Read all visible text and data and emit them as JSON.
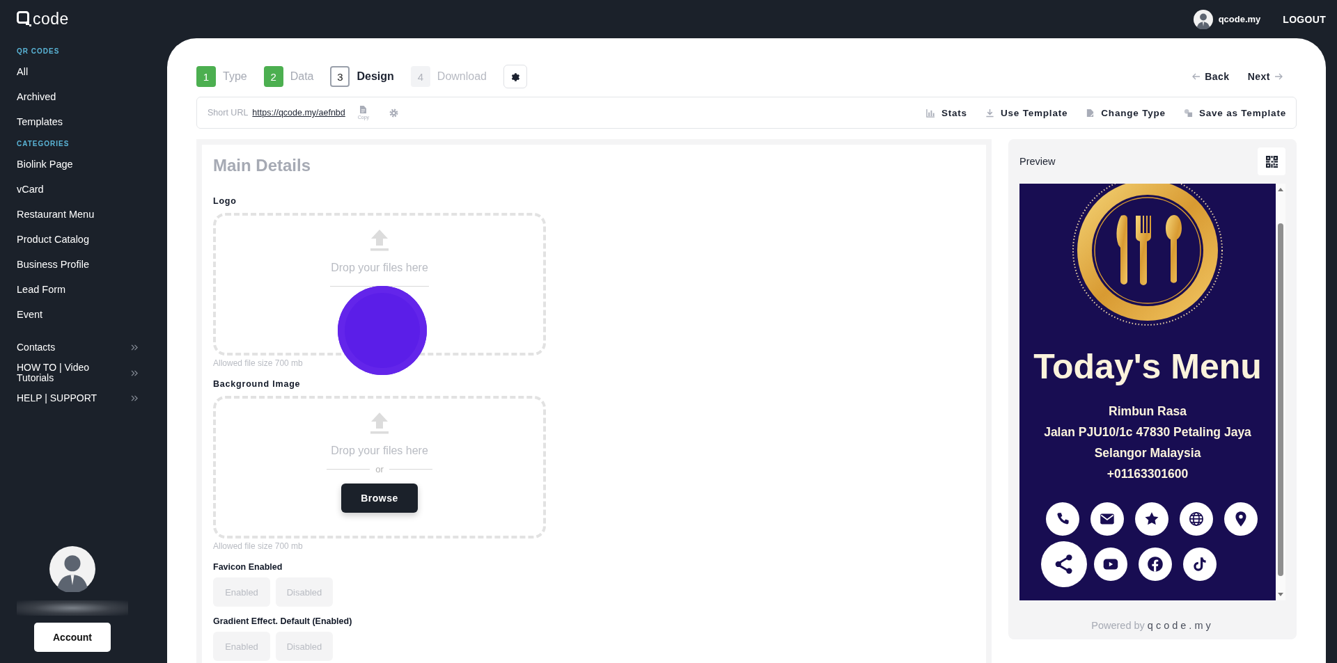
{
  "brand": {
    "text": "code"
  },
  "user": {
    "name": "qcode.my",
    "logout": "LOGOUT"
  },
  "sidebar": {
    "sections": [
      {
        "heading": "QR CODES",
        "items": [
          {
            "label": "All"
          },
          {
            "label": "Archived"
          },
          {
            "label": "Templates"
          }
        ]
      },
      {
        "heading": "CATEGORIES",
        "items": [
          {
            "label": "Biolink Page"
          },
          {
            "label": "vCard"
          },
          {
            "label": "Restaurant Menu"
          },
          {
            "label": "Product Catalog"
          },
          {
            "label": "Business Profile"
          },
          {
            "label": "Lead Form"
          },
          {
            "label": "Event"
          }
        ]
      }
    ],
    "links": [
      {
        "label": "Contacts"
      },
      {
        "label": "HOW TO | Video Tutorials"
      },
      {
        "label": "HELP | SUPPORT"
      }
    ],
    "account_button": "Account"
  },
  "steps": [
    {
      "number": "1",
      "label": "Type",
      "done": true,
      "selected": false
    },
    {
      "number": "2",
      "label": "Data",
      "done": true,
      "selected": false
    },
    {
      "number": "3",
      "label": "Design",
      "done": false,
      "selected": true
    },
    {
      "number": "4",
      "label": "Download",
      "done": false,
      "selected": false
    }
  ],
  "nav": {
    "back": "Back",
    "next": "Next"
  },
  "short_url": {
    "label": "Short URL",
    "url": "https://qcode.my/aefnbd",
    "copy": "Copy"
  },
  "toolbar": [
    {
      "label": "Stats",
      "kind": "stats"
    },
    {
      "label": "Use Template",
      "kind": "download"
    },
    {
      "label": "Change Type",
      "kind": "tag"
    },
    {
      "label": "Save as Template",
      "kind": "shapes"
    }
  ],
  "main": {
    "title": "Main Details",
    "uploads": [
      {
        "label": "Logo",
        "drop_text": "Drop your files here",
        "hint": "Allowed file size  700 mb",
        "click_marker": true
      },
      {
        "label": "Background Image",
        "drop_text": "Drop your files here",
        "separator": "or",
        "browse": "Browse",
        "hint": "Allowed file size  700 mb"
      }
    ],
    "toggles": [
      {
        "label": "Favicon Enabled",
        "options": [
          {
            "label": "Enabled",
            "selected": false
          },
          {
            "label": "Disabled",
            "selected": false
          }
        ]
      },
      {
        "label": "Gradient Effect. Default (Enabled)",
        "options": [
          {
            "label": "Enabled",
            "selected": false
          },
          {
            "label": "Disabled",
            "selected": false
          }
        ]
      }
    ]
  },
  "preview": {
    "title": "Preview",
    "heading": "Today's Menu",
    "lines": [
      "Rimbun Rasa",
      "Jalan PJU10/1c 47830 Petaling Jaya",
      "Selangor Malaysia",
      "+01163301600"
    ],
    "links": [
      {
        "kind": "phone"
      },
      {
        "kind": "mail"
      },
      {
        "kind": "star"
      },
      {
        "kind": "globe"
      },
      {
        "kind": "pin"
      },
      {
        "kind": "share"
      },
      {
        "kind": "youtube"
      },
      {
        "kind": "facebook"
      },
      {
        "kind": "tiktok"
      }
    ],
    "footer_prefix": "Powered by",
    "footer_brand": "qcode.my"
  }
}
